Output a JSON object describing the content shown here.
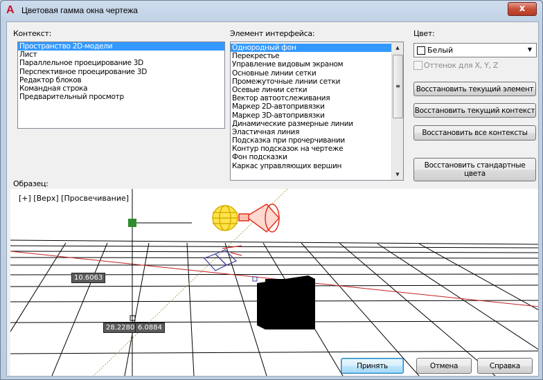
{
  "window": {
    "title": "Цветовая гамма окна чертежа",
    "close_label": "x"
  },
  "context": {
    "label": "Контекст:",
    "items": [
      "Пространство 2D-модели",
      "Лист",
      "Параллельное проецирование 3D",
      "Перспективное проецирование 3D",
      "Редактор блоков",
      "Командная строка",
      "Предварительный просмотр"
    ],
    "selected_index": 0
  },
  "interface_element": {
    "label": "Элемент интерфейса:",
    "items": [
      "Однородный фон",
      "Перекрестье",
      "Управление видовым экраном",
      "Основные линии сетки",
      "Промежуточные линии сетки",
      "Осевые линии сетки",
      "Вектор автоотслеживания",
      "Маркер 2D-автопривязки",
      "Маркер 3D-автопривязки",
      "Динамические размерные линии",
      "Эластичная линия",
      "Подсказка при прочерчивании",
      "Контур подсказок на чертеже",
      "Фон подсказки",
      "Каркас управляющих вершин"
    ],
    "selected_index": 0
  },
  "color": {
    "label": "Цвет:",
    "value": "Белый",
    "tint_label": "Оттенок для X, Y, Z"
  },
  "buttons": {
    "restore_element": "Восстановить текущий элемент",
    "restore_context": "Восстановить текущий контекст",
    "restore_all": "Восстановить все контексты",
    "restore_defaults": "Восстановить стандартные цвета",
    "apply": "Принять",
    "cancel": "Отмена",
    "help": "Справка"
  },
  "sample": {
    "label": "Образец:",
    "viewport_label": "[+] [Верх] [Просвечивание]",
    "dim_value": "10.6063",
    "coord_x": "28.2280",
    "coord_y": "6.0884"
  },
  "colors": {
    "selection": "#3399ff",
    "grid_center": "#d23b3b",
    "crosshair_dot": "#2e8b2e"
  }
}
